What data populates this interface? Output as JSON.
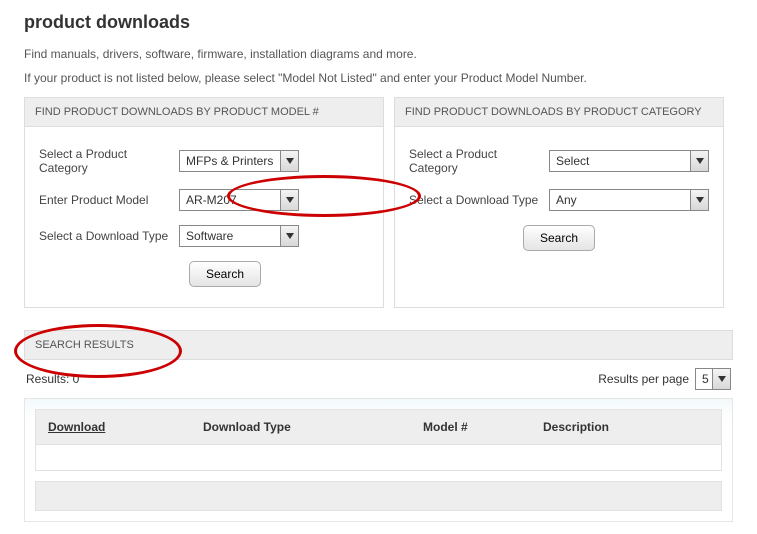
{
  "page": {
    "title": "product downloads",
    "intro1": "Find manuals, drivers, software, firmware, installation diagrams and more.",
    "intro2": "If your product is not listed below, please select \"Model Not Listed\" and enter your Product Model Number."
  },
  "left_panel": {
    "header": "FIND PRODUCT DOWNLOADS BY PRODUCT MODEL #",
    "category_label": "Select a Product Category",
    "category_value": "MFPs & Printers",
    "model_label": "Enter Product Model",
    "model_value": "AR-M207",
    "type_label": "Select a Download Type",
    "type_value": "Software",
    "search_label": "Search"
  },
  "right_panel": {
    "header": "FIND PRODUCT DOWNLOADS BY PRODUCT CATEGORY",
    "category_label": "Select a Product Category",
    "category_value": "Select",
    "type_label": "Select a Download Type",
    "type_value": "Any",
    "search_label": "Search"
  },
  "results": {
    "header": "SEARCH RESULTS",
    "count_label": "Results: 0",
    "rpp_label": "Results per page",
    "rpp_value": "5",
    "columns": {
      "download": "Download",
      "type": "Download Type",
      "model": "Model #",
      "desc": "Description"
    }
  }
}
